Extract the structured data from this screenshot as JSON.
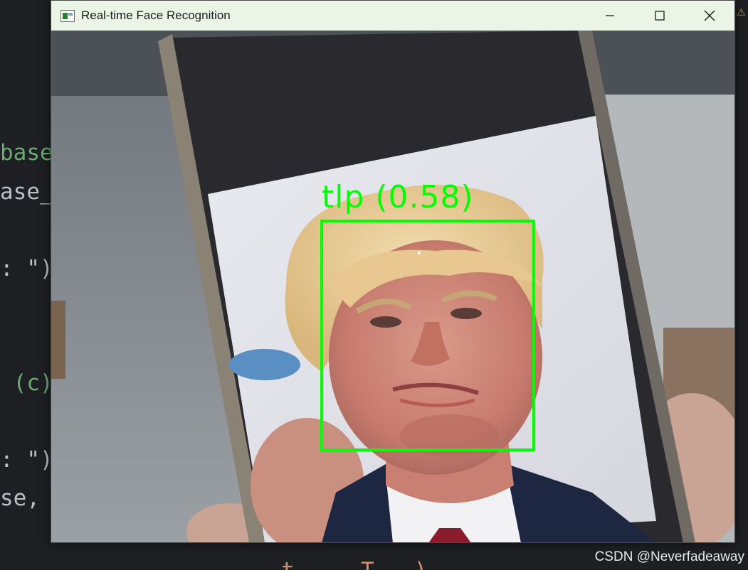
{
  "editor": {
    "lines": [
      {
        "text": "base",
        "color": "#6aab73"
      },
      {
        "text": "ase_",
        "color": "#bcbec4"
      },
      {
        "text": ": \")",
        "color": "#bcbec4"
      },
      {
        "text": " (c)",
        "color": "#6aab73"
      },
      {
        "text": ": \")",
        "color": "#bcbec4"
      },
      {
        "text": "se,",
        "color": "#bcbec4"
      },
      {
        "text": "t     T   )",
        "color": "#cf8e6d"
      }
    ],
    "right_icon": "warning-icon"
  },
  "window": {
    "title": "Real-time Face Recognition",
    "app_icon": "image-window-icon",
    "controls": [
      "minimize-icon",
      "maximize-icon",
      "close-icon"
    ],
    "titlebar_color": "#eaf5e6"
  },
  "video": {
    "detection": {
      "label": "tlp (0.58)",
      "box_color": "#00ff00"
    }
  },
  "watermark": "CSDN @Neverfadeaway"
}
